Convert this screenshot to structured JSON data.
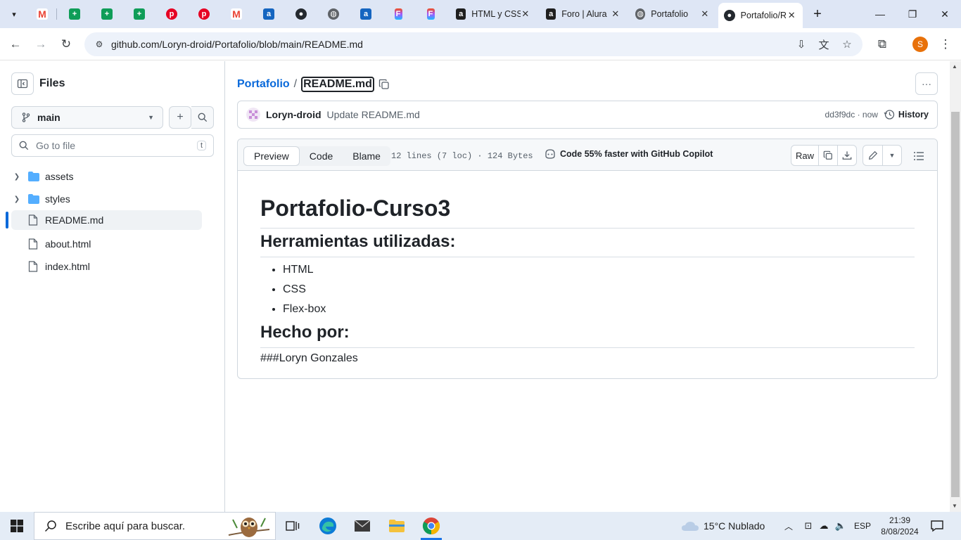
{
  "browser": {
    "pinned_tabs": [
      {
        "icon": "gmail-icon",
        "color": "#ea4335"
      },
      {
        "icon": "sheets-icon",
        "color": "#0f9d58"
      },
      {
        "icon": "sheets-icon",
        "color": "#0f9d58"
      },
      {
        "icon": "sheets-icon",
        "color": "#0f9d58"
      },
      {
        "icon": "pinterest-icon",
        "color": "#e60023"
      },
      {
        "icon": "pinterest-icon",
        "color": "#e60023"
      },
      {
        "icon": "gmail-icon",
        "color": "#ea4335"
      },
      {
        "icon": "alura-icon",
        "color": "#1565c0"
      },
      {
        "icon": "github-icon",
        "color": "#24292f"
      },
      {
        "icon": "globe-icon",
        "color": "#5f6368"
      },
      {
        "icon": "alura-icon",
        "color": "#1565c0"
      },
      {
        "icon": "figma-icon",
        "color": "#f24e1e"
      },
      {
        "icon": "figma-icon",
        "color": "#f24e1e"
      }
    ],
    "tabs": [
      {
        "title": "HTML y CSS",
        "icon": "alura-icon"
      },
      {
        "title": "Foro | Alura",
        "icon": "alura-icon"
      },
      {
        "title": "Portafolio",
        "icon": "globe-icon"
      },
      {
        "title": "Portafolio/README.md",
        "icon": "github-icon",
        "active": true
      }
    ],
    "url": "github.com/Loryn-droid/Portafolio/blob/main/README.md",
    "profile_initial": "S"
  },
  "sidebar": {
    "title": "Files",
    "branch": "main",
    "search_placeholder": "Go to file",
    "search_shortcut": "t",
    "tree": [
      {
        "label": "assets",
        "type": "folder"
      },
      {
        "label": "styles",
        "type": "folder"
      },
      {
        "label": "README.md",
        "type": "file",
        "active": true
      },
      {
        "label": "about.html",
        "type": "file"
      },
      {
        "label": "index.html",
        "type": "file"
      }
    ]
  },
  "main": {
    "breadcrumb": {
      "repo": "Portafolio",
      "separator": "/",
      "file": "README.md"
    },
    "commit": {
      "author": "Loryn-droid",
      "message": "Update README.md",
      "meta": "dd3f9dc · now",
      "history_label": "History"
    },
    "file": {
      "tabs": [
        "Preview",
        "Code",
        "Blame"
      ],
      "active_tab": "Preview",
      "info": "12 lines (7 loc) · 124 Bytes",
      "copilot": "Code 55% faster with GitHub Copilot",
      "raw_label": "Raw"
    },
    "readme": {
      "h1": "Portafolio-Curso3",
      "h2_tools": "Herramientas utilizadas:",
      "tools": [
        "HTML",
        "CSS",
        "Flex-box"
      ],
      "h2_author": "Hecho por:",
      "author_line": "###Loryn Gonzales"
    }
  },
  "taskbar": {
    "search_placeholder": "Escribe aquí para buscar.",
    "weather": "15°C  Nublado",
    "language": "ESP",
    "time": "21:39",
    "date": "8/08/2024"
  },
  "colors": {
    "link": "#0969da",
    "chrome_tabstrip": "#dee6f5",
    "taskbar": "#e4ecf6"
  }
}
